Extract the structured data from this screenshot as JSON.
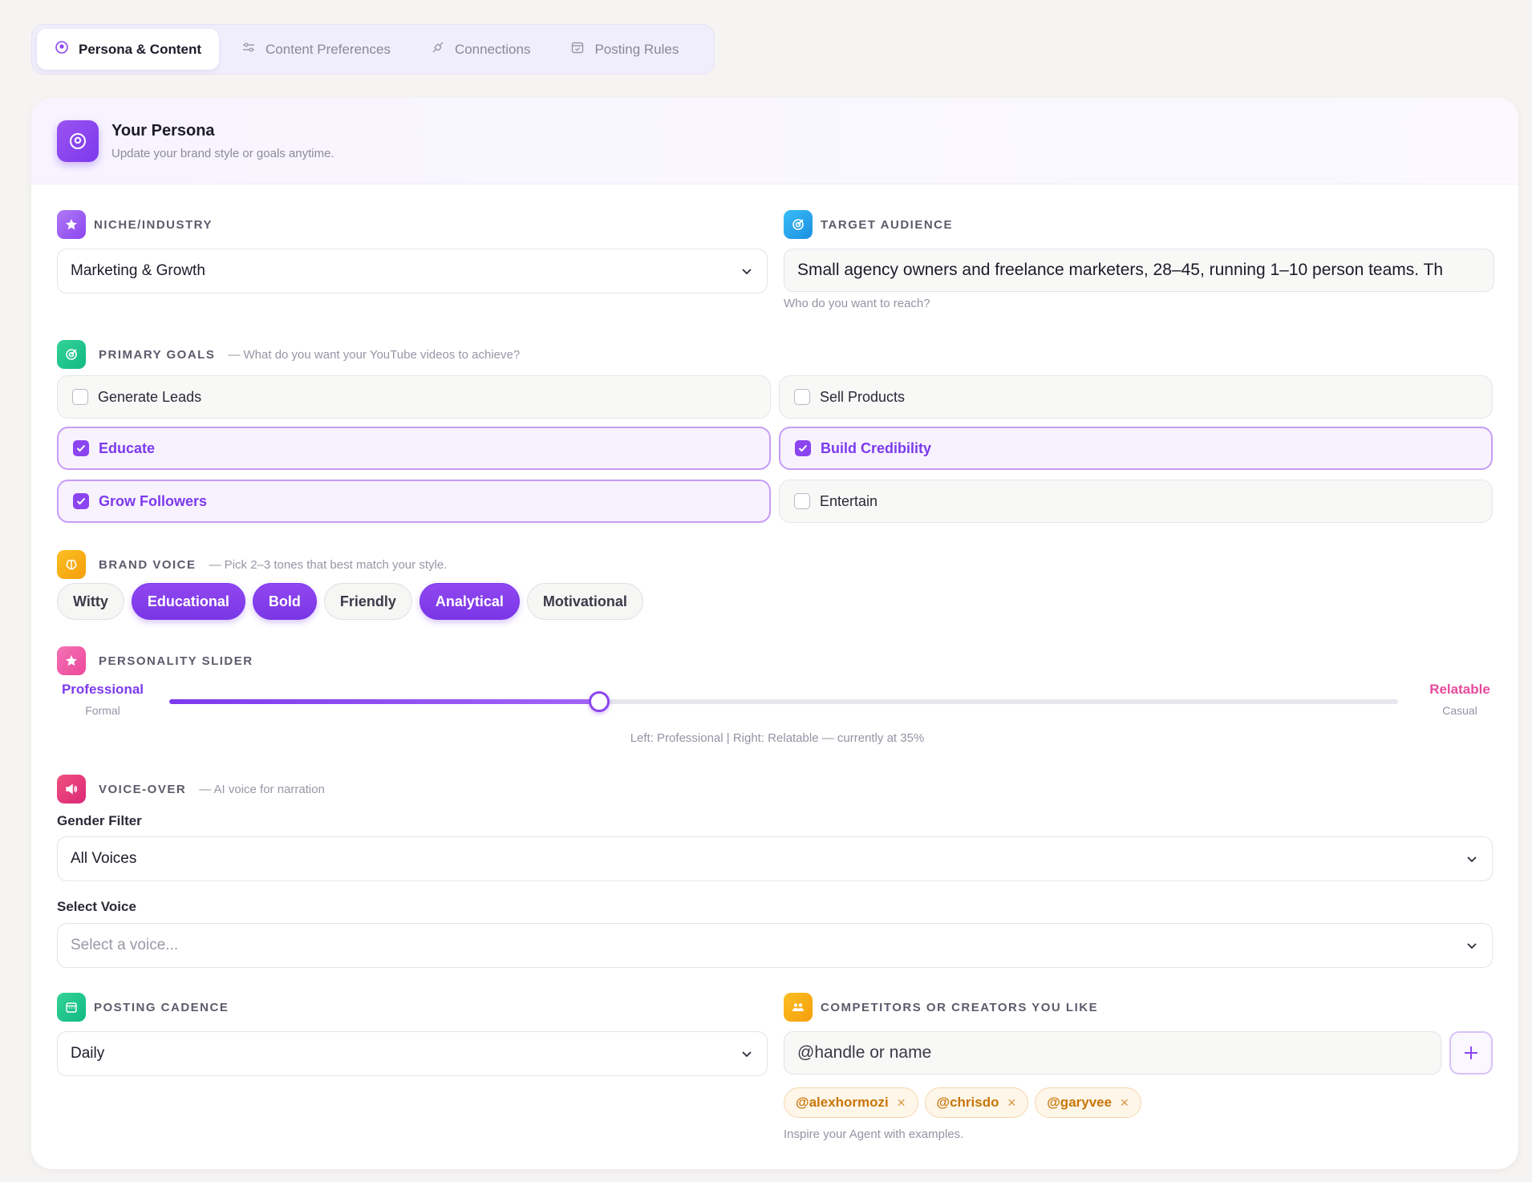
{
  "tabs": [
    {
      "label": "Persona & Content",
      "icon": "persona-icon",
      "active": true
    },
    {
      "label": "Content Preferences",
      "icon": "sliders-icon",
      "active": false
    },
    {
      "label": "Connections",
      "icon": "plug-icon",
      "active": false
    },
    {
      "label": "Posting Rules",
      "icon": "calendar-check-icon",
      "active": false
    }
  ],
  "header": {
    "title": "Your Persona",
    "subtitle": "Update your brand style or goals anytime."
  },
  "niche": {
    "label": "NICHE/INDUSTRY",
    "value": "Marketing & Growth"
  },
  "audience": {
    "label": "TARGET AUDIENCE",
    "value": "Small agency owners and freelance marketers, 28–45, running 1–10 person teams. Th",
    "helper": "Who do you want to reach?"
  },
  "goals": {
    "label": "PRIMARY GOALS",
    "hint": "— What do you want your YouTube videos to achieve?",
    "items": [
      {
        "label": "Generate Leads",
        "checked": false
      },
      {
        "label": "Sell Products",
        "checked": false
      },
      {
        "label": "Educate",
        "checked": true
      },
      {
        "label": "Build Credibility",
        "checked": true
      },
      {
        "label": "Grow Followers",
        "checked": true
      },
      {
        "label": "Entertain",
        "checked": false
      }
    ]
  },
  "voice": {
    "label": "BRAND VOICE",
    "hint": "— Pick 2–3 tones that best match your style.",
    "chips": [
      {
        "label": "Witty",
        "selected": false
      },
      {
        "label": "Educational",
        "selected": true
      },
      {
        "label": "Bold",
        "selected": true
      },
      {
        "label": "Friendly",
        "selected": false
      },
      {
        "label": "Analytical",
        "selected": true
      },
      {
        "label": "Motivational",
        "selected": false
      }
    ]
  },
  "personality": {
    "label": "PERSONALITY SLIDER",
    "left_label": "Professional",
    "left_sub": "Formal",
    "right_label": "Relatable",
    "right_sub": "Casual",
    "value_percent": 35,
    "caption": "Left: Professional | Right: Relatable — currently at 35%"
  },
  "voiceover": {
    "label": "VOICE-OVER",
    "hint": "— AI voice for narration",
    "gender_label": "Gender Filter",
    "gender_value": "All Voices",
    "select_label": "Select Voice",
    "select_placeholder": "Select a voice..."
  },
  "cadence": {
    "label": "POSTING CADENCE",
    "value": "Daily"
  },
  "competitors": {
    "label": "COMPETITORS OR CREATORS YOU LIKE",
    "placeholder": "@handle or name",
    "tags": [
      "@alexhormozi",
      "@chrisdo",
      "@garyvee"
    ],
    "helper": "Inspire your Agent with examples."
  },
  "colors": {
    "accent": "#7c3aed",
    "relatable": "#e54a9a",
    "tag_text": "#c87608"
  }
}
